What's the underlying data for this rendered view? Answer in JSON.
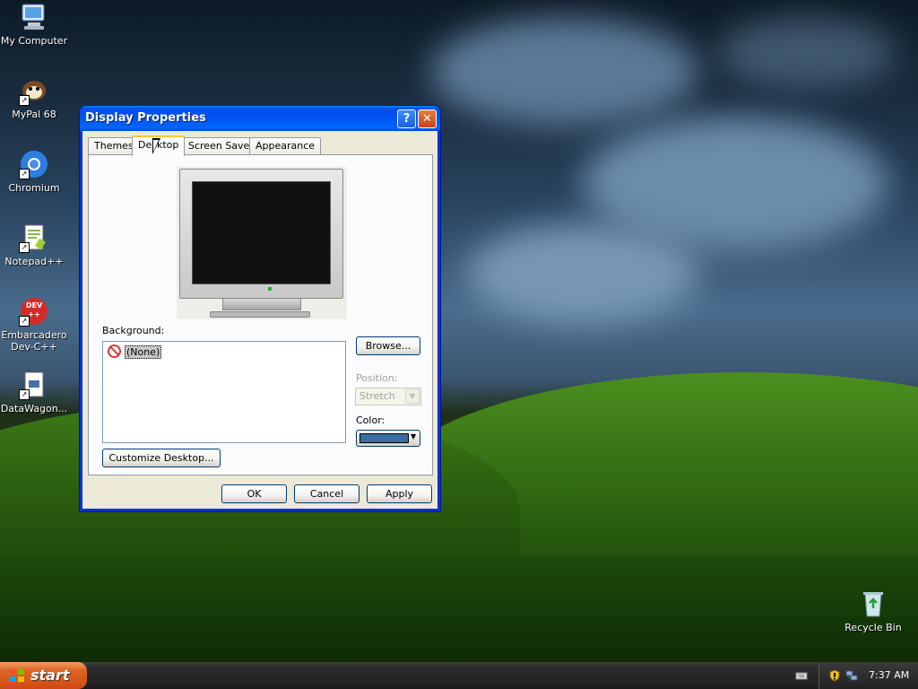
{
  "desktop": {
    "icons": [
      {
        "label": "My Computer",
        "icon": "my-computer-icon"
      },
      {
        "label": "MyPal 68",
        "icon": "mypal-icon"
      },
      {
        "label": "Chromium",
        "icon": "chromium-icon"
      },
      {
        "label": "Notepad++",
        "icon": "notepad-plus-plus-icon"
      },
      {
        "label": "Embarcadero Dev-C++",
        "icon": "dev-cpp-icon",
        "badge": "DEV ++"
      },
      {
        "label": "DataWagon...",
        "icon": "datawagon-icon"
      },
      {
        "label": "Recycle Bin",
        "icon": "recycle-bin-icon"
      }
    ]
  },
  "window": {
    "title": "Display Properties",
    "help_glyph": "?",
    "close_glyph": "✕",
    "tabs": [
      {
        "label": "Themes"
      },
      {
        "label": "Desktop",
        "active": true
      },
      {
        "label": "Screen Saver"
      },
      {
        "label": "Appearance"
      }
    ],
    "background_label": "Background:",
    "background_items": [
      "(None)"
    ],
    "browse_label": "Browse...",
    "position_label": "Position:",
    "position_value": "Stretch",
    "color_label": "Color:",
    "color_value": "#3a6ea5",
    "customize_label": "Customize Desktop...",
    "ok_label": "OK",
    "cancel_label": "Cancel",
    "apply_label": "Apply"
  },
  "taskbar": {
    "start_label": "start",
    "clock": "7:37 AM",
    "tray_icons": [
      "keyboard-icon",
      "security-shield-icon",
      "network-icon"
    ]
  },
  "colors": {
    "title_bar": "#0058ee",
    "start_button": "#e06428",
    "dialog_face": "#ece9d8",
    "desktop_color": "#3a6ea5"
  }
}
